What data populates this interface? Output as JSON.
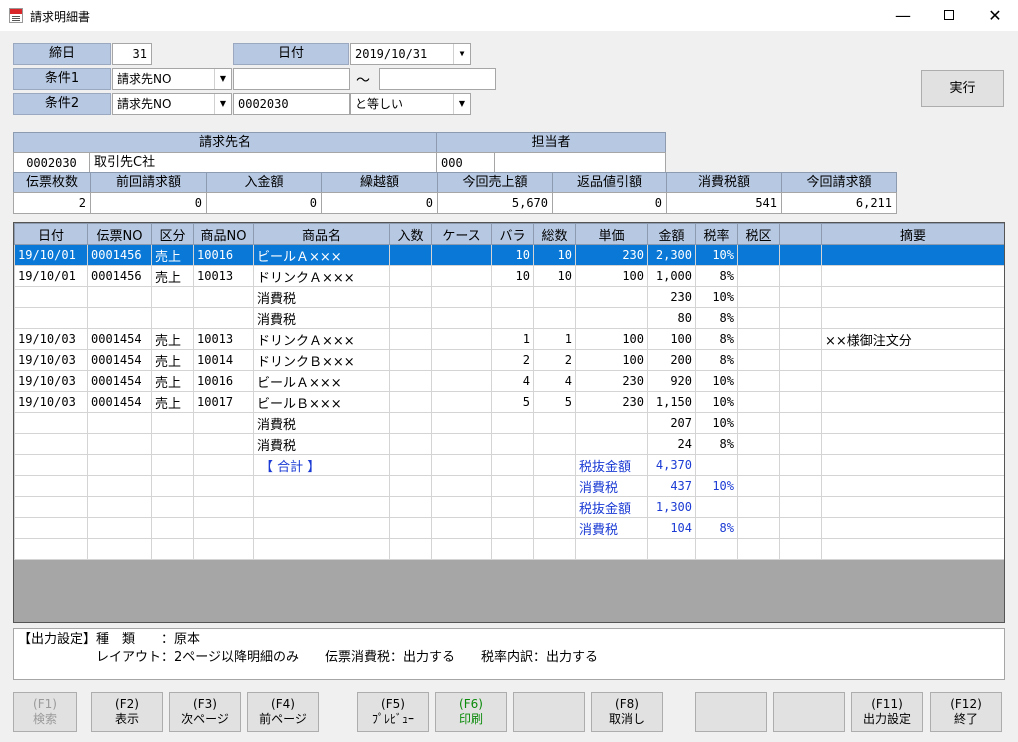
{
  "window": {
    "title": "請求明細書",
    "minimize": "—",
    "close": "✕"
  },
  "form": {
    "shimebi_label": "締日",
    "shimebi_value": "31",
    "date_label": "日付",
    "date_value": "2019/10/31",
    "cond1_label": "条件1",
    "cond1_field": "請求先NO",
    "cond1_from": "",
    "cond1_tilde": "～",
    "cond1_to": "",
    "cond2_label": "条件2",
    "cond2_field": "請求先NO",
    "cond2_value": "0002030",
    "cond2_op": "と等しい",
    "execute": "実行"
  },
  "customer": {
    "name_header": "請求先名",
    "staff_header": "担当者",
    "code": "0002030",
    "name": "取引先C社",
    "staff_code": "000",
    "staff_name": ""
  },
  "totals": {
    "headers": [
      "伝票枚数",
      "前回請求額",
      "入金額",
      "繰越額",
      "今回売上額",
      "返品値引額",
      "消費税額",
      "今回請求額"
    ],
    "values": [
      "2",
      "0",
      "0",
      "0",
      "5,670",
      "0",
      "541",
      "6,211"
    ]
  },
  "grid": {
    "columns": [
      "日付",
      "伝票NO",
      "区分",
      "商品NO",
      "商品名",
      "入数",
      "ケース",
      "バラ",
      "総数",
      "単価",
      "金額",
      "税率",
      "税区",
      "",
      "摘要"
    ],
    "rows": [
      [
        "19/10/01",
        "0001456",
        "売上",
        "10016",
        "ビールＡ×××",
        "",
        "",
        "10",
        "10",
        "230",
        "2,300",
        "10%",
        "",
        "",
        ""
      ],
      [
        "19/10/01",
        "0001456",
        "売上",
        "10013",
        "ドリンクＡ×××",
        "",
        "",
        "10",
        "10",
        "100",
        "1,000",
        "8%",
        "",
        "",
        ""
      ],
      [
        "",
        "",
        "",
        "",
        "消費税",
        "",
        "",
        "",
        "",
        "",
        "230",
        "10%",
        "",
        "",
        ""
      ],
      [
        "",
        "",
        "",
        "",
        "消費税",
        "",
        "",
        "",
        "",
        "",
        "80",
        "8%",
        "",
        "",
        ""
      ],
      [
        "19/10/03",
        "0001454",
        "売上",
        "10013",
        "ドリンクＡ×××",
        "",
        "",
        "1",
        "1",
        "100",
        "100",
        "8%",
        "",
        "",
        "××様御注文分"
      ],
      [
        "19/10/03",
        "0001454",
        "売上",
        "10014",
        "ドリンクＢ×××",
        "",
        "",
        "2",
        "2",
        "100",
        "200",
        "8%",
        "",
        "",
        ""
      ],
      [
        "19/10/03",
        "0001454",
        "売上",
        "10016",
        "ビールＡ×××",
        "",
        "",
        "4",
        "4",
        "230",
        "920",
        "10%",
        "",
        "",
        ""
      ],
      [
        "19/10/03",
        "0001454",
        "売上",
        "10017",
        "ビールＢ×××",
        "",
        "",
        "5",
        "5",
        "230",
        "1,150",
        "10%",
        "",
        "",
        ""
      ],
      [
        "",
        "",
        "",
        "",
        "消費税",
        "",
        "",
        "",
        "",
        "",
        "207",
        "10%",
        "",
        "",
        ""
      ],
      [
        "",
        "",
        "",
        "",
        "消費税",
        "",
        "",
        "",
        "",
        "",
        "24",
        "8%",
        "",
        "",
        ""
      ],
      [
        "",
        "",
        "",
        "",
        "【 合計 】",
        "",
        "",
        "",
        "",
        "税抜金額",
        "4,370",
        "",
        "",
        "",
        ""
      ],
      [
        "",
        "",
        "",
        "",
        "",
        "",
        "",
        "",
        "",
        "消費税",
        "437",
        "10%",
        "",
        "",
        ""
      ],
      [
        "",
        "",
        "",
        "",
        "",
        "",
        "",
        "",
        "",
        "税抜金額",
        "1,300",
        "",
        "",
        "",
        ""
      ],
      [
        "",
        "",
        "",
        "",
        "",
        "",
        "",
        "",
        "",
        "消費税",
        "104",
        "8%",
        "",
        "",
        ""
      ],
      [
        "",
        "",
        "",
        "",
        "",
        "",
        "",
        "",
        "",
        "",
        "",
        "",
        "",
        "",
        ""
      ]
    ]
  },
  "output_settings": {
    "line1": "【出力設定】種　類　　：原本",
    "line2": "　　　　　　レイアウト：2ページ以降明細のみ　　伝票消費税：出力する　　税率内訳：出力する"
  },
  "fkeys": [
    {
      "key": "(F1)",
      "label": "検索",
      "state": "disabled"
    },
    {
      "key": "(F2)",
      "label": "表示",
      "state": "normal"
    },
    {
      "key": "(F3)",
      "label": "次ページ",
      "state": "normal"
    },
    {
      "key": "(F4)",
      "label": "前ページ",
      "state": "normal"
    },
    {
      "key": "(F5)",
      "label": "ﾌﾟﾚﾋﾞｭｰ",
      "state": "normal"
    },
    {
      "key": "(F6)",
      "label": "印刷",
      "state": "green"
    },
    {
      "key": "",
      "label": "",
      "state": "normal"
    },
    {
      "key": "(F8)",
      "label": "取消し",
      "state": "normal"
    },
    {
      "key": "",
      "label": "",
      "state": "normal"
    },
    {
      "key": "",
      "label": "",
      "state": "normal"
    },
    {
      "key": "(F11)",
      "label": "出力設定",
      "state": "normal"
    },
    {
      "key": "(F12)",
      "label": "終了",
      "state": "normal"
    }
  ],
  "colors": {
    "header": "#b7c9e2",
    "selection": "#0a78d7",
    "total_text": "#1b3bd4",
    "print_green": "#0a8a0a"
  }
}
